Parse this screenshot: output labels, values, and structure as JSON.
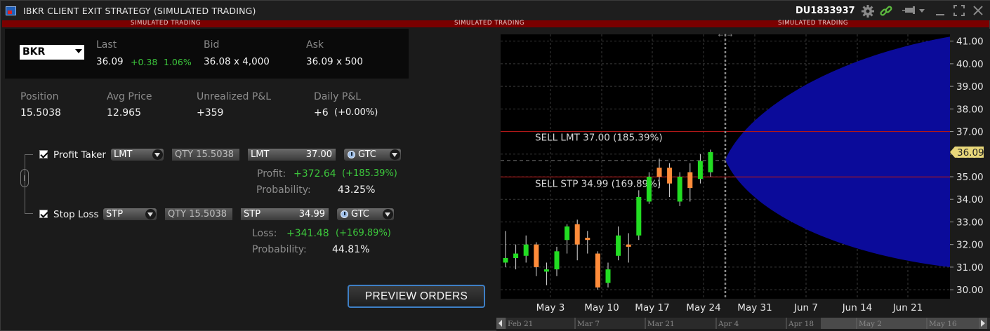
{
  "window": {
    "title": "IBKR CLIENT EXIT STRATEGY (SIMULATED TRADING)",
    "account": "DU1833937",
    "banner": [
      "SIMULATED TRADING",
      "SIMULATED TRADING",
      "SIMULATED TRADING"
    ]
  },
  "icons": [
    "app-icon",
    "gear-icon",
    "link-icon",
    "pin-icon",
    "chevron-down-icon",
    "minimize-icon",
    "maximize-icon",
    "close-icon",
    "clock-icon",
    "dropdown-icon",
    "chain-link-icon"
  ],
  "quote": {
    "symbol": "BKR",
    "last_label": "Last",
    "last": "36.09",
    "change": "+0.38",
    "change_pct": "1.06%",
    "bid_label": "Bid",
    "bid": "36.08 x 4,000",
    "ask_label": "Ask",
    "ask": "36.09 x 500"
  },
  "position": {
    "position_label": "Position",
    "position": "15.5038",
    "avg_label": "Avg Price",
    "avg": "12.965",
    "unreal_label": "Unrealized P&L",
    "unreal": "+359",
    "daily_label": "Daily P&L",
    "daily": "+6",
    "daily_pct": "(+0.00%)"
  },
  "profit_taker": {
    "label": "Profit Taker",
    "order_type": "LMT",
    "qty": "QTY 15.5038",
    "price_type": "LMT",
    "price": "37.00",
    "tif": "GTC",
    "result_label": "Profit:",
    "result": "+372.64",
    "result_pct": "(+185.39%)",
    "prob_label": "Probability:",
    "prob": "43.25%"
  },
  "stop_loss": {
    "label": "Stop Loss",
    "order_type": "STP",
    "qty": "QTY 15.5038",
    "price_type": "STP",
    "price": "34.99",
    "tif": "GTC",
    "result_label": "Loss:",
    "result": "+341.48",
    "result_pct": "(+169.89%)",
    "prob_label": "Probability:",
    "prob": "44.81%"
  },
  "preview_button": "PREVIEW ORDERS",
  "colors": {
    "accent_blue": "#3e7fc6",
    "gain_green": "#3cc63c",
    "banner_red": "#7b0000",
    "cone_blue": "#0b0b9a",
    "line_red": "#b01818",
    "candle_up": "#22dd22",
    "candle_down": "#ff8c3a",
    "price_tag": "#e8d77a"
  },
  "chart_data": {
    "type": "candlestick",
    "y_ticks": [
      "41.00",
      "40.00",
      "39.00",
      "38.00",
      "37.00",
      "36.00",
      "35.00",
      "34.00",
      "33.00",
      "32.00",
      "31.00",
      "30.00"
    ],
    "ylim": [
      29.6,
      41.3
    ],
    "x_ticks": [
      "May 3",
      "May 10",
      "May 17",
      "May 24",
      "May 31",
      "Jun 7",
      "Jun 14",
      "Jun 21"
    ],
    "current_price": "36.09",
    "lines": [
      {
        "label": "SELL LMT 37.00 (185.39%)",
        "price": 37.0
      },
      {
        "label": "SELL STP 34.99 (169.89%)",
        "price": 34.99
      }
    ],
    "candles": [
      {
        "o": 31.2,
        "h": 32.6,
        "l": 31.0,
        "c": 31.4
      },
      {
        "o": 31.4,
        "h": 32.0,
        "l": 30.9,
        "c": 31.6
      },
      {
        "o": 31.5,
        "h": 32.4,
        "l": 31.2,
        "c": 32.0
      },
      {
        "o": 32.0,
        "h": 32.1,
        "l": 30.6,
        "c": 31.0
      },
      {
        "o": 30.8,
        "h": 31.2,
        "l": 30.2,
        "c": 30.9
      },
      {
        "o": 30.9,
        "h": 31.9,
        "l": 30.6,
        "c": 31.7
      },
      {
        "o": 32.2,
        "h": 32.9,
        "l": 31.6,
        "c": 32.8
      },
      {
        "o": 32.9,
        "h": 33.1,
        "l": 31.3,
        "c": 32.0
      },
      {
        "o": 32.3,
        "h": 32.6,
        "l": 31.6,
        "c": 32.2
      },
      {
        "o": 31.6,
        "h": 31.7,
        "l": 30.0,
        "c": 30.1
      },
      {
        "o": 30.3,
        "h": 31.2,
        "l": 30.1,
        "c": 30.9
      },
      {
        "o": 31.5,
        "h": 32.8,
        "l": 31.3,
        "c": 32.4
      },
      {
        "o": 32.0,
        "h": 32.5,
        "l": 31.2,
        "c": 31.9
      },
      {
        "o": 32.4,
        "h": 34.4,
        "l": 32.2,
        "c": 34.1
      },
      {
        "o": 33.9,
        "h": 35.2,
        "l": 33.8,
        "c": 35.0
      },
      {
        "o": 35.4,
        "h": 35.8,
        "l": 34.5,
        "c": 35.0
      },
      {
        "o": 35.4,
        "h": 35.6,
        "l": 34.1,
        "c": 34.7
      },
      {
        "o": 33.9,
        "h": 35.2,
        "l": 33.7,
        "c": 35.0
      },
      {
        "o": 35.2,
        "h": 35.6,
        "l": 33.9,
        "c": 34.5
      },
      {
        "o": 34.9,
        "h": 36.0,
        "l": 34.7,
        "c": 35.7
      },
      {
        "o": 35.2,
        "h": 36.2,
        "l": 35.0,
        "c": 36.09
      }
    ],
    "cone": {
      "start_price": 35.75,
      "upper_end": 41.2,
      "lower_end": 31.0
    },
    "scroller_labels": [
      "Feb 21",
      "Mar 7",
      "Mar 21",
      "Apr 4",
      "Apr 18",
      "May 2",
      "May 16"
    ]
  }
}
